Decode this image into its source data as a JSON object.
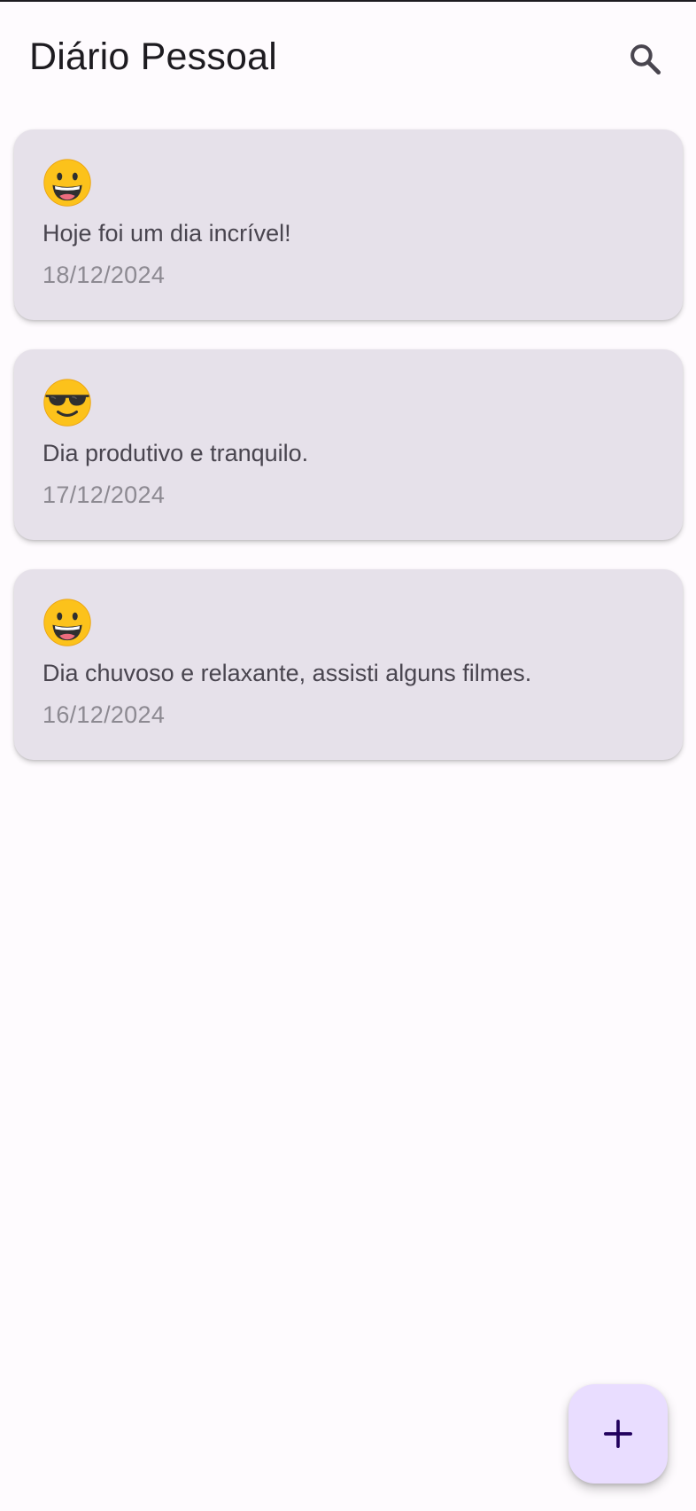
{
  "app_bar": {
    "title": "Diário Pessoal",
    "search_icon": "search-icon"
  },
  "entries": [
    {
      "mood_icon": "grinning-face-emoji",
      "text": "Hoje foi um dia incrível!",
      "date": "18/12/2024"
    },
    {
      "mood_icon": "smiling-face-with-sunglasses-emoji",
      "text": "Dia produtivo e tranquilo.",
      "date": "17/12/2024"
    },
    {
      "mood_icon": "grinning-face-emoji",
      "text": "Dia chuvoso e relaxante, assisti alguns filmes.",
      "date": "16/12/2024"
    }
  ],
  "fab": {
    "icon": "plus-icon"
  },
  "colors": {
    "background": "#fefbfe",
    "card": "#e6e1ea",
    "fab": "#e9ddff",
    "fab_icon": "#21005d",
    "title": "#1d1b20",
    "entry_text": "#49454f",
    "date_text": "#8d8a92"
  }
}
